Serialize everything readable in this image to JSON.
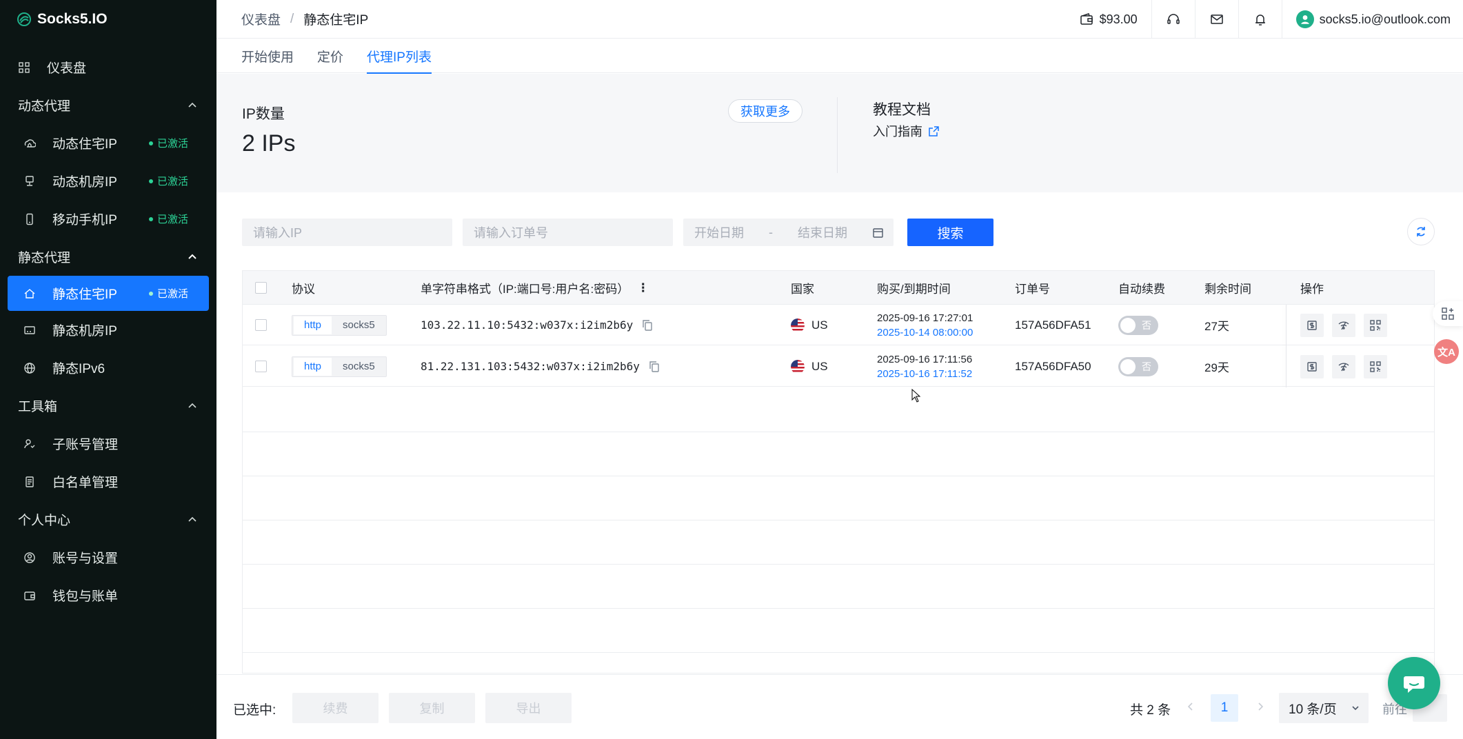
{
  "brand": {
    "name": "Socks5.IO",
    "accent": "#1677ff",
    "sidebar_bg": "#0c1514",
    "success": "#2cd296"
  },
  "sidebar": {
    "dashboard": {
      "label": "仪表盘",
      "icon": "grid-icon"
    },
    "groups": [
      {
        "title": "动态代理",
        "items": [
          {
            "label": "动态住宅IP",
            "icon": "cloud-home-icon",
            "badge": "已激活"
          },
          {
            "label": "动态机房IP",
            "icon": "server-icon",
            "badge": "已激活"
          },
          {
            "label": "移动手机IP",
            "icon": "mobile-icon",
            "badge": "已激活"
          }
        ]
      },
      {
        "title": "静态代理",
        "items": [
          {
            "label": "静态住宅IP",
            "icon": "home-icon",
            "badge": "已激活",
            "active": true
          },
          {
            "label": "静态机房IP",
            "icon": "rack-icon"
          },
          {
            "label": "静态IPv6",
            "icon": "globe-icon"
          }
        ]
      },
      {
        "title": "工具箱",
        "items": [
          {
            "label": "子账号管理",
            "icon": "users-icon"
          },
          {
            "label": "白名单管理",
            "icon": "document-icon"
          }
        ]
      },
      {
        "title": "个人中心",
        "items": [
          {
            "label": "账号与设置",
            "icon": "user-circle-icon"
          },
          {
            "label": "钱包与账单",
            "icon": "wallet-icon"
          }
        ]
      }
    ]
  },
  "topbar": {
    "breadcrumb": [
      "仪表盘",
      "静态住宅IP"
    ],
    "separator": "/",
    "balance": "$93.00",
    "email": "socks5.io@outlook.com"
  },
  "tabs": [
    {
      "label": "开始使用"
    },
    {
      "label": "定价"
    },
    {
      "label": "代理IP列表",
      "active": true
    }
  ],
  "stats": {
    "count_label": "IP数量",
    "count_value": "2 IPs",
    "get_more": "获取更多",
    "docs_title": "教程文档",
    "docs_link": "入门指南"
  },
  "filters": {
    "ip_placeholder": "请输入IP",
    "order_placeholder": "请输入订单号",
    "start_date": "开始日期",
    "date_sep": "-",
    "end_date": "结束日期",
    "search": "搜索"
  },
  "table": {
    "headers": {
      "protocol": "协议",
      "format": "单字符串格式（IP:端口号:用户名:密码）",
      "country": "国家",
      "time": "购买/到期时间",
      "order": "订单号",
      "renew": "自动续费",
      "remaining": "剩余时间",
      "ops": "操作"
    },
    "rows": [
      {
        "proto_a": "http",
        "proto_b": "socks5",
        "string": "103.22.11.10:5432:w037x:i2im2b6y",
        "country": "US",
        "buy": "2025-09-16 17:27:01",
        "expire": "2025-10-14 08:00:00",
        "order": "157A56DFA51",
        "renew": "否",
        "remaining": "27天"
      },
      {
        "proto_a": "http",
        "proto_b": "socks5",
        "string": "81.22.131.103:5432:w037x:i2im2b6y",
        "country": "US",
        "buy": "2025-09-16 17:11:56",
        "expire": "2025-10-16 17:11:52",
        "order": "157A56DFA50",
        "renew": "否",
        "remaining": "29天"
      }
    ]
  },
  "footer": {
    "selected": "已选中:",
    "renew": "续费",
    "copy": "复制",
    "export": "导出",
    "total": "共 2 条",
    "page": "1",
    "page_size": "10 条/页",
    "goto": "前往"
  },
  "floating": {
    "translate": "文A"
  }
}
